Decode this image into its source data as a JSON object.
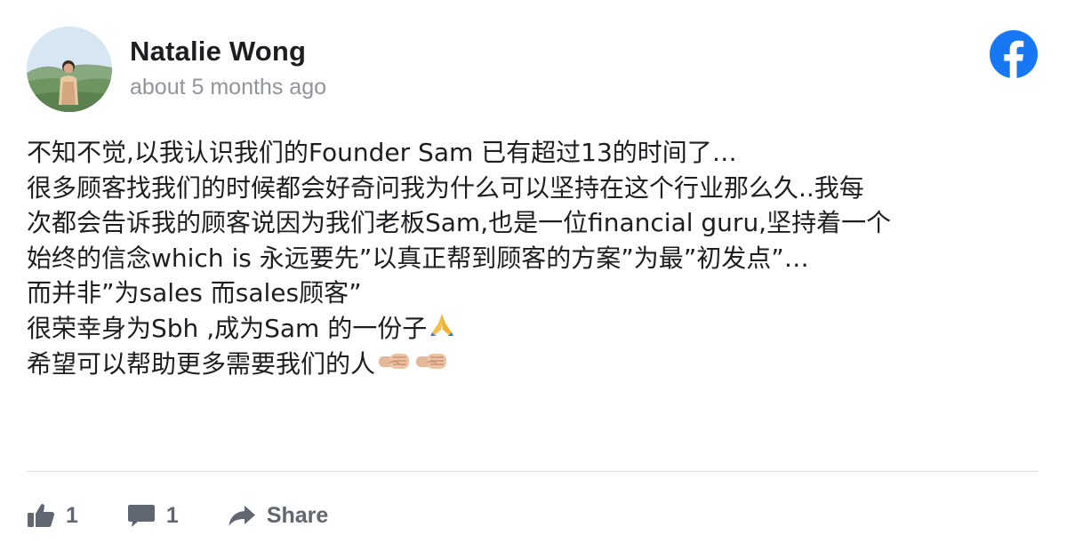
{
  "post": {
    "author_name": "Natalie Wong",
    "timestamp": "about 5 months ago",
    "network_icon": "facebook-logo-icon",
    "brand_color": "#1877f2",
    "body_lines": [
      "不知不觉,以我认识我们的Founder Sam 已有超过13的时间了…",
      "很多顾客找我们的时候都会好奇问我为什么可以坚持在这个行业那么久..我每",
      "次都会告诉我的顾客说因为我们老板Sam,也是一位financial guru,坚持着一个",
      "始终的信念which is 永远要先”以真正帮到顾客的方案”为最”初发点”…",
      "而并非”为sales 而sales顾客”",
      "很荣幸身为Sbh ,成为Sam 的一份子",
      "希望可以帮助更多需要我们的人"
    ],
    "emojis": {
      "line6": "folded-hands-icon",
      "line7": [
        "left-facing-fist-icon",
        "left-facing-fist-icon"
      ]
    }
  },
  "actions": {
    "like_count": "1",
    "comment_count": "1",
    "share_label": "Share",
    "text_color": "#606770"
  }
}
